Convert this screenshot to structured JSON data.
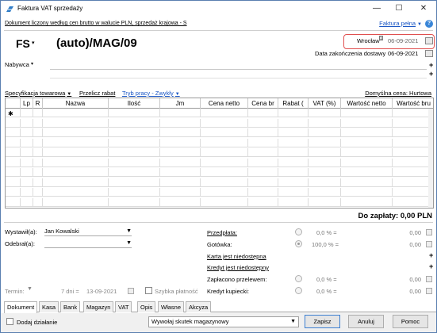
{
  "window": {
    "title": "Faktura VAT sprzedaży",
    "minimize": "—",
    "maximize": "☐",
    "close": "✕"
  },
  "subheader": {
    "info": "Dokument liczony według cen brutto w walucie PLN, sprzedaż krajowa - S",
    "mode_link": "Faktura pełna",
    "mode_caret": "▼",
    "help": "?"
  },
  "document": {
    "type": "FS",
    "type_caret": "▾",
    "number": "(auto)/MAG/09",
    "place_label": "Wrocław",
    "place_sup": "1",
    "issue_date": "06-09-2021",
    "delivery_label": "Data zakończenia dostawy",
    "delivery_date": "06-09-2021"
  },
  "buyer": {
    "label": "Nabywca",
    "caret": "▾",
    "add": "+"
  },
  "items_toolbar": {
    "spec_label": "Specyfikacja towarowa",
    "spec_caret": "▼",
    "recalc": "Przelicz rabat",
    "workmode": "Tryb pracy - Zwykły",
    "workmode_caret": "▼",
    "default_price": "Domyślna cena: Hurtowa"
  },
  "grid": {
    "columns": [
      "Lp",
      "R",
      "Nazwa",
      "Ilość",
      "Jm",
      "Cena netto",
      "Cena br",
      "Rabat (",
      "VAT (%)",
      "Wartość netto",
      "Wartość bru"
    ],
    "new_row_marker": "✱",
    "rows": 10
  },
  "total": {
    "label": "Do zapłaty: 0,00 PLN"
  },
  "people": {
    "issued_label": "Wystawił(a):",
    "issued_value": "Jan Kowalski",
    "received_label": "Odebrał(a):",
    "received_value": ""
  },
  "payments": {
    "prepayment_label": "Przedpłata:",
    "prepayment_pct": "0,0 % =",
    "prepayment_amt": "0,00",
    "cash_label": "Gotówka:",
    "cash_pct": "100,0 % =",
    "cash_amt": "0,00",
    "card_label": "Karta jest niedostępna",
    "credit_label": "Kredyt jest niedostępny",
    "transfer_label": "Zapłacono przelewem:",
    "transfer_pct": "0,0 % =",
    "transfer_amt": "0,00",
    "merchant_credit_label": "Kredyt kupiecki:",
    "merchant_credit_pct": "0,0 % =",
    "merchant_credit_amt": "0,00"
  },
  "term": {
    "label": "Termin:",
    "days": "7 dni =",
    "date": "13-09-2021",
    "quick_pay": "Szybka płatność"
  },
  "tabs": [
    "Dokument",
    "Kasa",
    "Bank",
    "Magazyn",
    "VAT",
    "Opis",
    "Własne",
    "Akcyza"
  ],
  "footer": {
    "add_action": "Dodaj działanie",
    "warehouse_effect": "Wywołaj skutek magazynowy",
    "save": "Zapisz",
    "cancel": "Anuluj",
    "help": "Pomoc"
  }
}
